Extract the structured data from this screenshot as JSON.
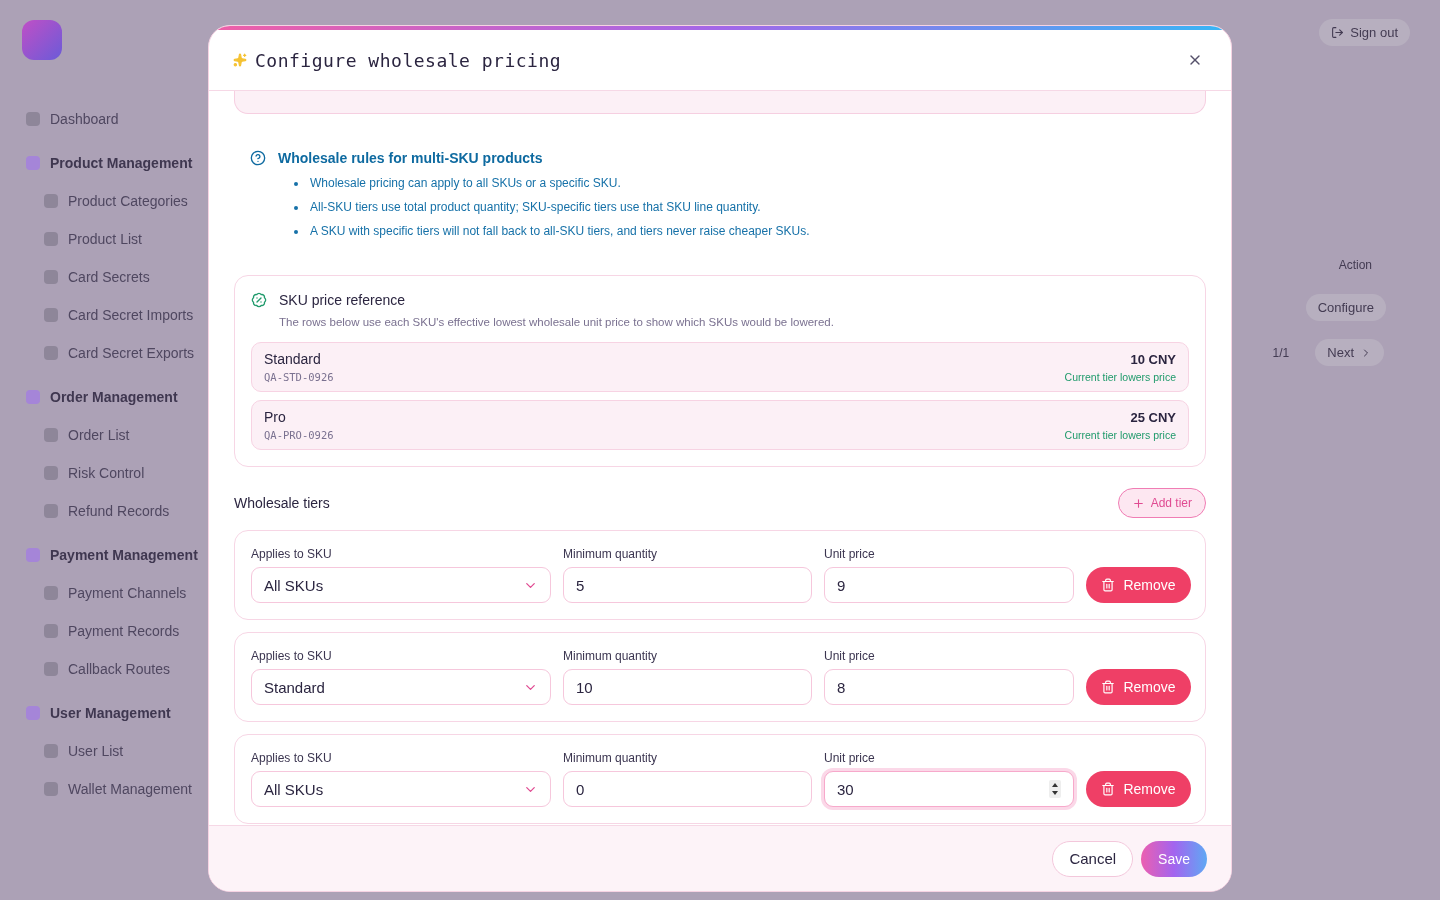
{
  "backdrop": {
    "sidebar": [
      {
        "kind": "item",
        "label": "Dashboard"
      },
      {
        "kind": "group",
        "label": "Product Management"
      },
      {
        "kind": "sub",
        "label": "Product Categories"
      },
      {
        "kind": "sub",
        "label": "Product List"
      },
      {
        "kind": "sub",
        "label": "Card Secrets"
      },
      {
        "kind": "sub",
        "label": "Card Secret Imports"
      },
      {
        "kind": "sub",
        "label": "Card Secret Exports"
      },
      {
        "kind": "group",
        "label": "Order Management"
      },
      {
        "kind": "sub",
        "label": "Order List"
      },
      {
        "kind": "sub",
        "label": "Risk Control"
      },
      {
        "kind": "sub",
        "label": "Refund Records"
      },
      {
        "kind": "group",
        "label": "Payment Management"
      },
      {
        "kind": "sub",
        "label": "Payment Channels"
      },
      {
        "kind": "sub",
        "label": "Payment Records"
      },
      {
        "kind": "sub",
        "label": "Callback Routes"
      },
      {
        "kind": "group",
        "label": "User Management"
      },
      {
        "kind": "sub",
        "label": "User List"
      },
      {
        "kind": "sub",
        "label": "Wallet Management"
      }
    ],
    "sign_out": "Sign out",
    "column_action": "Action",
    "configure_button": "Configure",
    "page": "1/1",
    "next": "Next"
  },
  "dialog": {
    "title": "Configure wholesale pricing",
    "rules": {
      "title": "Wholesale rules for multi-SKU products",
      "items": [
        "Wholesale pricing can apply to all SKUs or a specific SKU.",
        "All-SKU tiers use total product quantity; SKU-specific tiers use that SKU line quantity.",
        "A SKU with specific tiers will not fall back to all-SKU tiers, and tiers never raise cheaper SKUs."
      ]
    },
    "reference": {
      "title": "SKU price reference",
      "description": "The rows below use each SKU's effective lowest wholesale unit price to show which SKUs would be lowered.",
      "rows": [
        {
          "name": "Standard",
          "code": "QA-STD-0926",
          "price": "10 CNY",
          "note": "Current tier lowers price"
        },
        {
          "name": "Pro",
          "code": "QA-PRO-0926",
          "price": "25 CNY",
          "note": "Current tier lowers price"
        }
      ]
    },
    "tiers_title": "Wholesale tiers",
    "add_button": "Add tier",
    "tiers": [
      {
        "sku_label": "Applies to SKU",
        "sku": "All SKUs",
        "qty_label": "Minimum quantity",
        "qty": "5",
        "price_label": "Unit price",
        "price": "9",
        "focused": false,
        "remove": "Remove"
      },
      {
        "sku_label": "Applies to SKU",
        "sku": "Standard",
        "qty_label": "Minimum quantity",
        "qty": "10",
        "price_label": "Unit price",
        "price": "8",
        "focused": false,
        "remove": "Remove"
      },
      {
        "sku_label": "Applies to SKU",
        "sku": "All SKUs",
        "qty_label": "Minimum quantity",
        "qty": "0",
        "price_label": "Unit price",
        "price": "30",
        "focused": true,
        "remove": "Remove"
      }
    ],
    "buttons": {
      "cancel": "Cancel",
      "save": "Save"
    }
  }
}
